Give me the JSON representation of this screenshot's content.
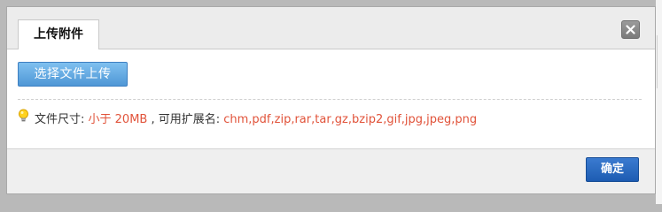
{
  "dialog": {
    "tab_label": "上传附件",
    "close_icon": "close-icon",
    "upload_button_label": "选择文件上传",
    "hint": {
      "icon": "lightbulb-icon",
      "size_label": "文件尺寸: ",
      "size_value": "小于 20MB",
      "ext_label": " , 可用扩展名: ",
      "ext_value": "chm,pdf,zip,rar,tar,gz,bzip2,gif,jpg,jpeg,png"
    },
    "confirm_button_label": "确定"
  },
  "colors": {
    "highlight_text": "#e1533a",
    "primary_button": "#1d5cb2",
    "upload_button": "#4f97d6"
  }
}
